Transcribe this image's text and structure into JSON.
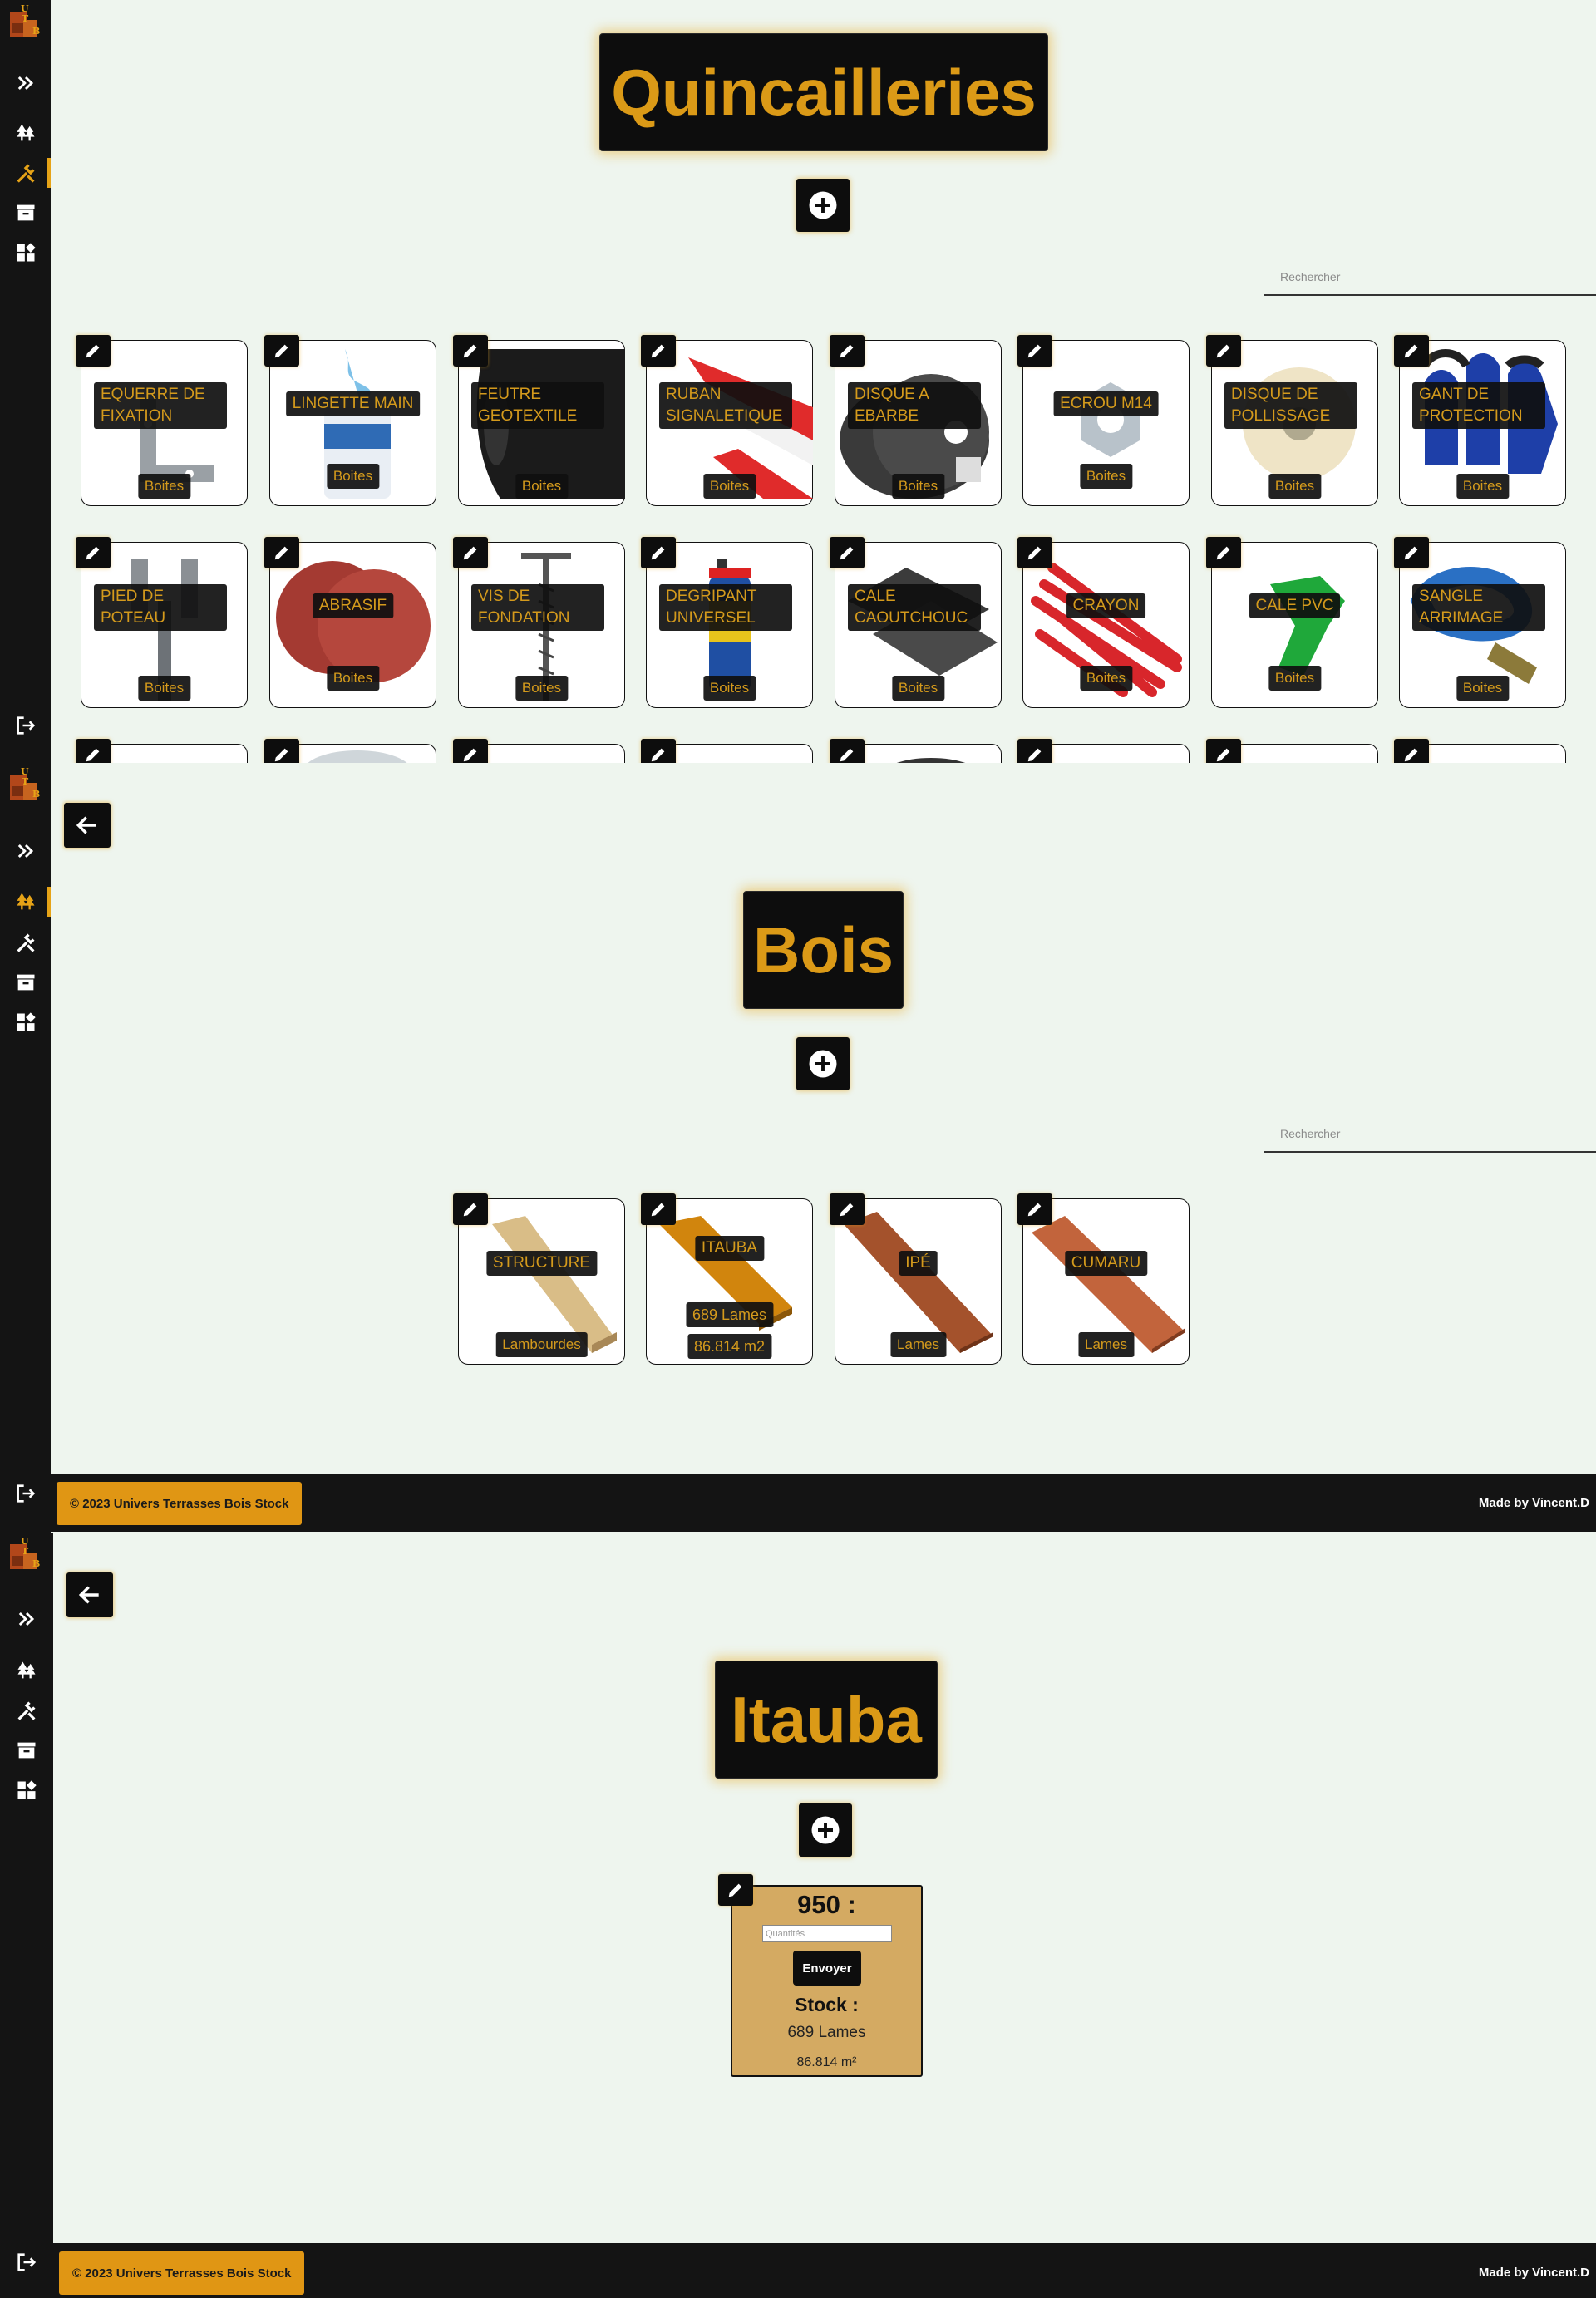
{
  "brand": {
    "logo_letters": [
      "U",
      "T",
      "B"
    ]
  },
  "icons": {
    "expand": "double-chevron-right-icon",
    "wood": "trees-icon",
    "hardware": "tools-icon",
    "storage": "archive-box-icon",
    "categories": "grid-plus-icon",
    "logout": "logout-icon",
    "add": "plus-circle-icon",
    "edit": "pencil-icon",
    "back": "arrow-left-icon"
  },
  "colors": {
    "accent": "#e6a317",
    "sidebar": "#141414",
    "background": "#eef5ee",
    "stock_card": "#d4aa62"
  },
  "quincailleries": {
    "title": "Quincailleries",
    "search_placeholder": "Rechercher",
    "items": [
      {
        "name": "EQUERRE DE FIXATION",
        "unit": "Boites"
      },
      {
        "name": "LINGETTE MAIN",
        "unit": "Boites"
      },
      {
        "name": "FEUTRE GEOTEXTILE",
        "unit": "Boites"
      },
      {
        "name": "RUBAN SIGNALETIQUE",
        "unit": "Boites"
      },
      {
        "name": "DISQUE A EBARBE",
        "unit": "Boites"
      },
      {
        "name": "ECROU M14",
        "unit": "Boites"
      },
      {
        "name": "DISQUE DE POLLISSAGE",
        "unit": "Boites"
      },
      {
        "name": "GANT DE PROTECTION",
        "unit": "Boites"
      },
      {
        "name": "PIED DE POTEAU",
        "unit": "Boites"
      },
      {
        "name": "ABRASIF",
        "unit": "Boites"
      },
      {
        "name": "VIS DE FONDATION",
        "unit": "Boites"
      },
      {
        "name": "DEGRIPANT UNIVERSEL",
        "unit": "Boites"
      },
      {
        "name": "CALE CAOUTCHOUC",
        "unit": "Boites"
      },
      {
        "name": "CRAYON",
        "unit": "Boites"
      },
      {
        "name": "CALE PVC",
        "unit": "Boites"
      },
      {
        "name": "SANGLE ARRIMAGE",
        "unit": "Boites"
      }
    ]
  },
  "bois": {
    "title": "Bois",
    "search_placeholder": "Rechercher",
    "items": [
      {
        "name": "STRUCTURE",
        "unit": "Lambourdes"
      },
      {
        "name": "ITAUBA",
        "count": "689 Lames",
        "area": "86.814 m2"
      },
      {
        "name": "IPÉ",
        "unit": "Lames"
      },
      {
        "name": "CUMARU",
        "unit": "Lames"
      }
    ]
  },
  "itauba": {
    "title": "Itauba",
    "card": {
      "title": "950 :",
      "input_placeholder": "Quantités",
      "send_label": "Envoyer",
      "stock_label": "Stock :",
      "lames": "689 Lames",
      "area": "86.814 m²"
    }
  },
  "footer": {
    "copyright": "© 2023 Univers Terrasses Bois Stock",
    "credit": "Made by Vincent.D"
  }
}
